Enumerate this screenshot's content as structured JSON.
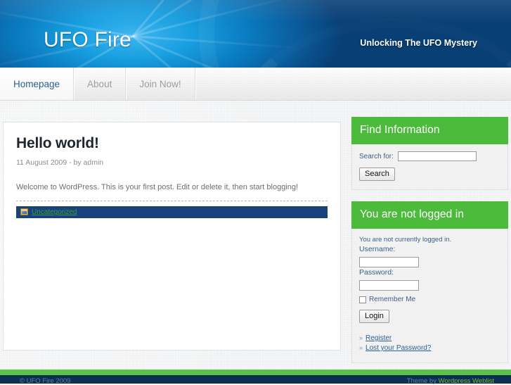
{
  "site": {
    "title": "UFO Fire",
    "tagline": "Unlocking The UFO Mystery"
  },
  "nav": {
    "items": [
      {
        "label": "Homepage",
        "active": true
      },
      {
        "label": "About",
        "active": false
      },
      {
        "label": "Join Now!",
        "active": false
      }
    ]
  },
  "post": {
    "title": "Hello world!",
    "meta": "11 August 2009 - by admin",
    "body": "Welcome to WordPress. This is your first post. Edit or delete it, then start blogging!",
    "category_icon": "folder-image-icon",
    "category_label": "Uncategorized"
  },
  "sidebar": {
    "search_widget": {
      "heading": "Find Information",
      "label": "Search for:",
      "input_value": "",
      "input_placeholder": "",
      "button_label": "Search"
    },
    "login_widget": {
      "heading": "You are not logged in",
      "note": "You are not currently logged in.",
      "username_label": "Username:",
      "username_value": "",
      "password_label": "Password:",
      "password_value": "",
      "remember_label": "Remember Me",
      "login_button_label": "Login",
      "bullet": "»",
      "links": [
        {
          "label": "Register"
        },
        {
          "label": "Lost your Password?"
        }
      ]
    }
  },
  "footer": {
    "copyright": "© UFO Fire 2009",
    "credit_prefix": "Theme by ",
    "credit_link_1": "Wordpress",
    "credit_sep": " ",
    "credit_link_2": "Weblist"
  },
  "colors": {
    "green": "#4cbb3c",
    "footer_green": "#5bc24a",
    "footer_dark": "#0d3052",
    "banner_blue": "#0a5d9e",
    "category_bar": "#17427c",
    "link_blue": "#2a5f92",
    "category_link_green": "#3f9c3f"
  }
}
